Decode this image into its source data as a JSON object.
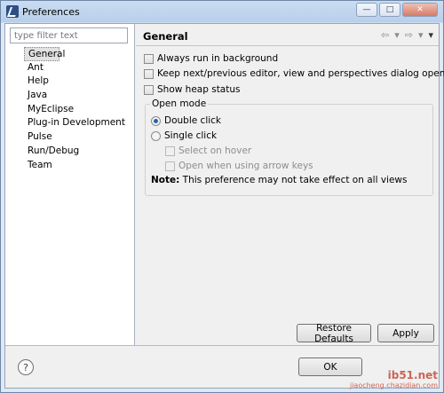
{
  "window": {
    "title": "Preferences",
    "controls": {
      "minimize": "—",
      "maximize": "□",
      "close": "✕"
    }
  },
  "sidebar": {
    "filter_placeholder": "type filter text",
    "items": [
      {
        "label": "General",
        "selected": true
      },
      {
        "label": "Ant"
      },
      {
        "label": "Help"
      },
      {
        "label": "Java"
      },
      {
        "label": "MyEclipse"
      },
      {
        "label": "Plug-in Development"
      },
      {
        "label": "Pulse"
      },
      {
        "label": "Run/Debug"
      },
      {
        "label": "Team"
      }
    ]
  },
  "page": {
    "title": "General",
    "nav": {
      "back": "⇦",
      "back_menu": "▾",
      "forward": "⇨",
      "forward_menu": "▾",
      "view_menu": "▾"
    },
    "options": [
      {
        "label": "Always run in background",
        "checked": false
      },
      {
        "label": "Keep next/previous editor, view and perspectives dialog open",
        "checked": false
      },
      {
        "label": "Show heap status",
        "checked": false
      }
    ],
    "open_mode": {
      "title": "Open mode",
      "double_click": "Double click",
      "single_click": "Single click",
      "select_on_hover": "Select on hover",
      "open_arrow_keys": "Open when using arrow keys",
      "selected": "Double click"
    },
    "note_label": "Note:",
    "note_text": " This preference may not take effect on all views",
    "restore_defaults": "Restore Defaults",
    "apply": "Apply"
  },
  "footer": {
    "help_icon": "?",
    "ok": "OK"
  },
  "watermark": {
    "line1": "ib51.net",
    "line2": "jiaocheng.chazidian.com"
  }
}
